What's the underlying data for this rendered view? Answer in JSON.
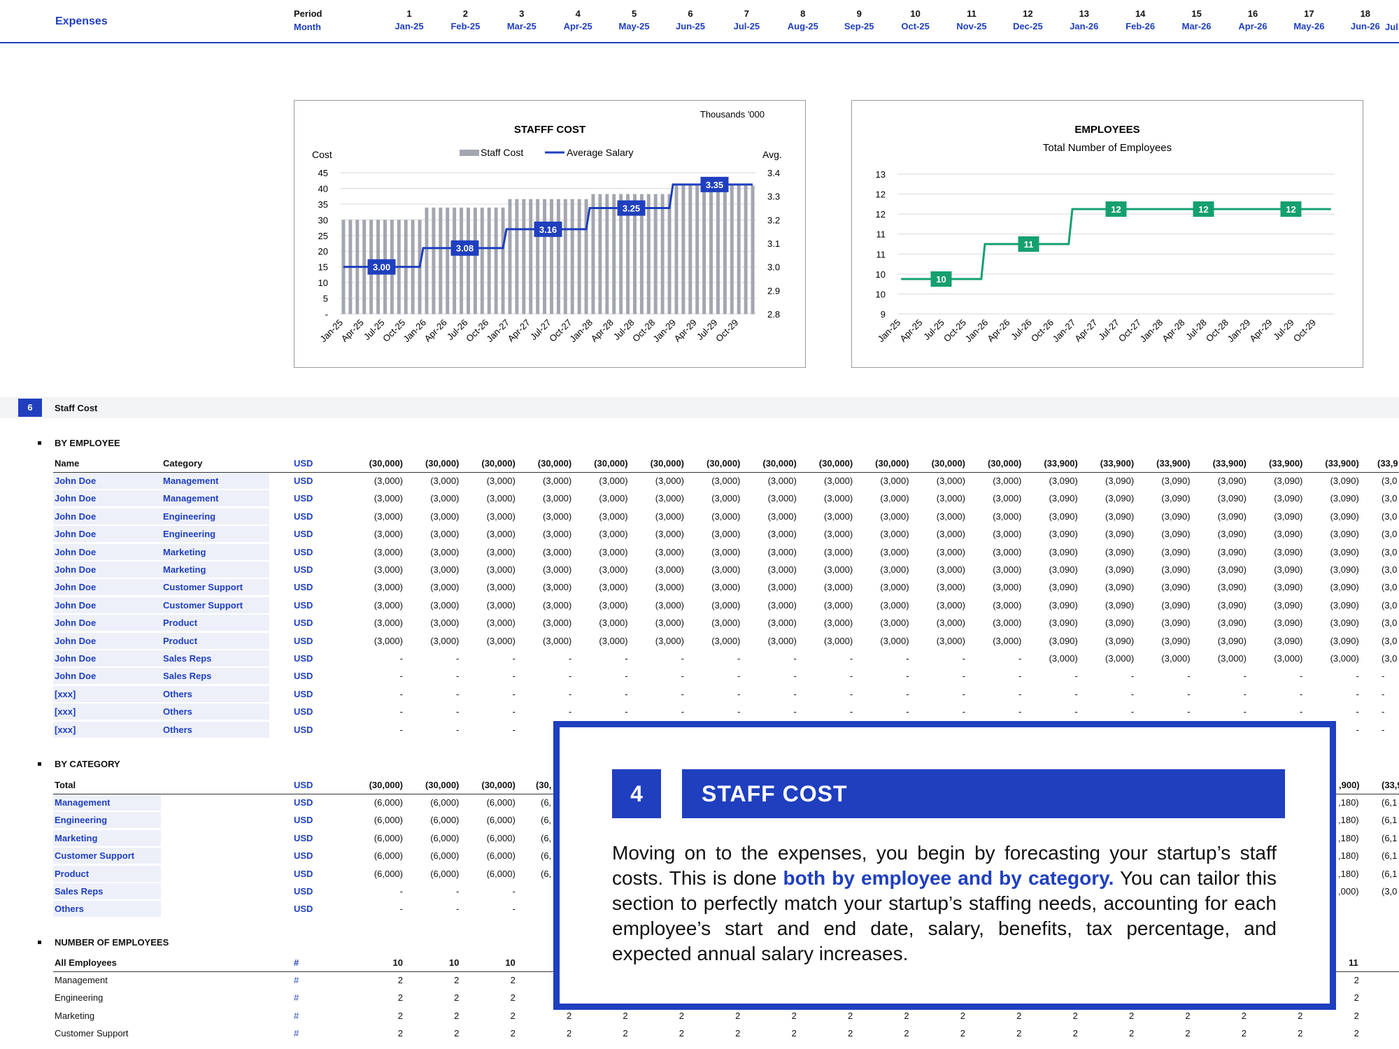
{
  "header": {
    "title": "Expenses",
    "period_label": "Period",
    "month_label": "Month",
    "periods": [
      "1",
      "2",
      "3",
      "4",
      "5",
      "6",
      "7",
      "8",
      "9",
      "10",
      "11",
      "12",
      "13",
      "14",
      "15",
      "16",
      "17",
      "18"
    ],
    "months": [
      "Jan-25",
      "Feb-25",
      "Mar-25",
      "Apr-25",
      "May-25",
      "Jun-25",
      "Jul-25",
      "Aug-25",
      "Sep-25",
      "Oct-25",
      "Nov-25",
      "Dec-25",
      "Jan-26",
      "Feb-26",
      "Mar-26",
      "Apr-26",
      "May-26",
      "Jun-26"
    ],
    "partial_month": "Jul"
  },
  "chart_data": [
    {
      "type": "bar",
      "title": "STAFFF COST",
      "units_note": "Thousands '000",
      "ylabel": "Cost",
      "y2label": "Avg.",
      "legend": [
        "Staff Cost",
        "Average Salary"
      ],
      "ylim": [
        0,
        45
      ],
      "y_ticks": [
        "45",
        "40",
        "35",
        "30",
        "25",
        "20",
        "15",
        "10",
        "5",
        "-"
      ],
      "y2lim": [
        2.8,
        3.4
      ],
      "y2_ticks": [
        "3.4",
        "3.3",
        "3.2",
        "3.1",
        "3.0",
        "2.9",
        "2.8"
      ],
      "x_ticks": [
        "Jan-25",
        "Apr-25",
        "Jul-25",
        "Oct-25",
        "Jan-26",
        "Apr-26",
        "Jul-26",
        "Oct-26",
        "Jan-27",
        "Apr-27",
        "Jul-27",
        "Oct-27",
        "Jan-28",
        "Apr-28",
        "Jul-28",
        "Oct-28",
        "Jan-29",
        "Apr-29",
        "Jul-29",
        "Oct-29"
      ],
      "series": [
        {
          "name": "Staff Cost",
          "kind": "bar",
          "yearly_values": [
            30.0,
            33.9,
            36.6,
            38.2,
            40.9
          ]
        },
        {
          "name": "Average Salary",
          "kind": "line",
          "yearly_values": [
            3.0,
            3.08,
            3.16,
            3.25,
            3.35
          ]
        }
      ],
      "data_labels": [
        "3.00",
        "3.08",
        "3.16",
        "3.25",
        "3.35"
      ],
      "colors": {
        "bar": "#a3a6b0",
        "line": "#1f3fbf"
      }
    },
    {
      "type": "line",
      "title": "EMPLOYEES",
      "subtitle": "Total Number of Employees",
      "ylim": [
        9,
        13
      ],
      "y_ticks": [
        "13",
        "12",
        "12",
        "11",
        "11",
        "10",
        "10",
        "9"
      ],
      "x_ticks": [
        "Jan-25",
        "Apr-25",
        "Jul-25",
        "Oct-25",
        "Jan-26",
        "Apr-26",
        "Jul-26",
        "Oct-26",
        "Jan-27",
        "Apr-27",
        "Jul-27",
        "Oct-27",
        "Jan-28",
        "Apr-28",
        "Jul-28",
        "Oct-28",
        "Jan-29",
        "Apr-29",
        "Jul-29",
        "Oct-29"
      ],
      "series": [
        {
          "name": "Employees",
          "yearly_values": [
            10,
            11,
            12,
            12,
            12
          ]
        }
      ],
      "data_labels": [
        "10",
        "11",
        "12",
        "12",
        "12"
      ],
      "colors": {
        "line": "#15a06f"
      }
    }
  ],
  "section": {
    "number": "6",
    "title": "Staff Cost"
  },
  "by_employee": {
    "heading": "BY EMPLOYEE",
    "col_name": "Name",
    "col_category": "Category",
    "unit": "USD",
    "totals": [
      "(30,000)",
      "(30,000)",
      "(30,000)",
      "(30,000)",
      "(30,000)",
      "(30,000)",
      "(30,000)",
      "(30,000)",
      "(30,000)",
      "(30,000)",
      "(30,000)",
      "(30,000)",
      "(33,900)",
      "(33,900)",
      "(33,900)",
      "(33,900)",
      "(33,900)",
      "(33,900)"
    ],
    "total_partial": "(33,9",
    "rows": [
      {
        "name": "John Doe",
        "category": "Management",
        "a": "(3,000)",
        "b": "(3,090)",
        "p": "(3,0"
      },
      {
        "name": "John Doe",
        "category": "Management",
        "a": "(3,000)",
        "b": "(3,090)",
        "p": "(3,0"
      },
      {
        "name": "John Doe",
        "category": "Engineering",
        "a": "(3,000)",
        "b": "(3,090)",
        "p": "(3,0"
      },
      {
        "name": "John Doe",
        "category": "Engineering",
        "a": "(3,000)",
        "b": "(3,090)",
        "p": "(3,0"
      },
      {
        "name": "John Doe",
        "category": "Marketing",
        "a": "(3,000)",
        "b": "(3,090)",
        "p": "(3,0"
      },
      {
        "name": "John Doe",
        "category": "Marketing",
        "a": "(3,000)",
        "b": "(3,090)",
        "p": "(3,0"
      },
      {
        "name": "John Doe",
        "category": "Customer Support",
        "a": "(3,000)",
        "b": "(3,090)",
        "p": "(3,0"
      },
      {
        "name": "John Doe",
        "category": "Customer Support",
        "a": "(3,000)",
        "b": "(3,090)",
        "p": "(3,0"
      },
      {
        "name": "John Doe",
        "category": "Product",
        "a": "(3,000)",
        "b": "(3,090)",
        "p": "(3,0"
      },
      {
        "name": "John Doe",
        "category": "Product",
        "a": "(3,000)",
        "b": "(3,090)",
        "p": "(3,0"
      },
      {
        "name": "John Doe",
        "category": "Sales Reps",
        "a": "-",
        "b": "(3,000)",
        "p": "(3,0"
      },
      {
        "name": "John Doe",
        "category": "Sales Reps",
        "a": "-",
        "b": "-",
        "p": "-"
      },
      {
        "name": "[xxx]",
        "category": "Others",
        "a": "-",
        "b": "-",
        "p": "-"
      },
      {
        "name": "[xxx]",
        "category": "Others",
        "a": "-",
        "b": "-",
        "p": "-"
      },
      {
        "name": "[xxx]",
        "category": "Others",
        "a": "-",
        "b": "-",
        "p": "-"
      }
    ]
  },
  "by_category": {
    "heading": "BY CATEGORY",
    "total_label": "Total",
    "unit": "USD",
    "totals_left": [
      "(30,000)",
      "(30,000)",
      "(30,000)"
    ],
    "total_clip_left": "(30,",
    "total_clip_right": ",900)",
    "total_right_partial": "(33,9",
    "rows": [
      {
        "label": "Management",
        "left": [
          "(6,000)",
          "(6,000)",
          "(6,000)"
        ],
        "clip_left": "(6,",
        "clip_right": ",180)",
        "right_partial": "(6,1"
      },
      {
        "label": "Engineering",
        "left": [
          "(6,000)",
          "(6,000)",
          "(6,000)"
        ],
        "clip_left": "(6,",
        "clip_right": ",180)",
        "right_partial": "(6,1"
      },
      {
        "label": "Marketing",
        "left": [
          "(6,000)",
          "(6,000)",
          "(6,000)"
        ],
        "clip_left": "(6,",
        "clip_right": ",180)",
        "right_partial": "(6,1"
      },
      {
        "label": "Customer Support",
        "left": [
          "(6,000)",
          "(6,000)",
          "(6,000)"
        ],
        "clip_left": "(6,",
        "clip_right": ",180)",
        "right_partial": "(6,1"
      },
      {
        "label": "Product",
        "left": [
          "(6,000)",
          "(6,000)",
          "(6,000)"
        ],
        "clip_left": "(6,",
        "clip_right": ",180)",
        "right_partial": "(6,1"
      },
      {
        "label": "Sales Reps",
        "left": [
          "-",
          "-",
          "-"
        ],
        "clip_left": "",
        "clip_right": ",000)",
        "right_partial": "(3,0"
      },
      {
        "label": "Others",
        "left": [
          "-",
          "-",
          "-"
        ],
        "clip_left": "",
        "clip_right": "",
        "right_partial": ""
      }
    ]
  },
  "num_employees": {
    "heading": "NUMBER OF EMPLOYEES",
    "all_label": "All Employees",
    "unit": "#",
    "all_left": [
      "10",
      "10",
      "10"
    ],
    "all_right": "11",
    "rows": [
      {
        "label": "Management",
        "v": "2"
      },
      {
        "label": "Engineering",
        "v": "2"
      },
      {
        "label": "Marketing",
        "v": "2"
      },
      {
        "label": "Customer Support",
        "v": "2"
      }
    ]
  },
  "callout": {
    "number": "4",
    "title": "STAFF COST",
    "text_before": "Moving on to the expenses, you begin by forecasting your startup’s staff costs. This is done ",
    "text_highlight": "both by employee and by category.",
    "text_after": " You can tailor this section to perfectly match your startup’s staffing needs, accounting for each employee’s start and end date, salary, benefits, tax percentage, and expected annual salary increases."
  }
}
